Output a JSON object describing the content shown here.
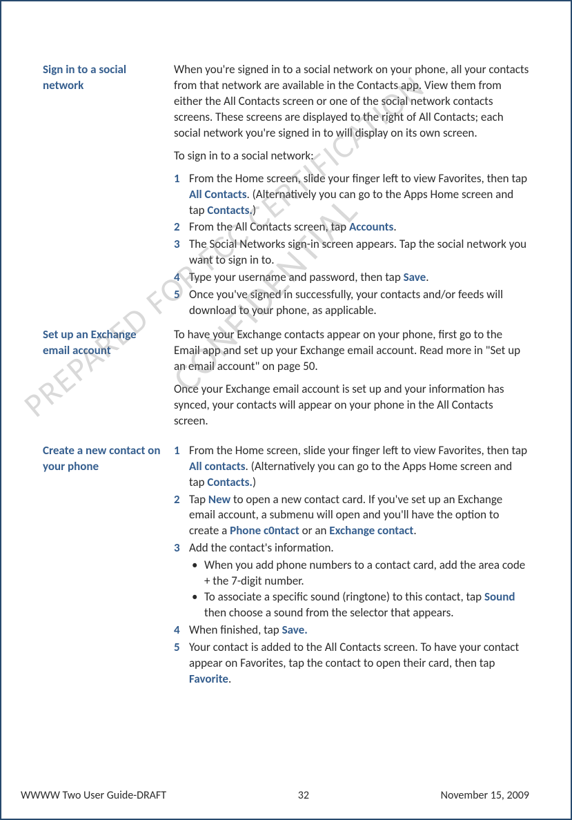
{
  "watermarks": {
    "wm1": "PREPARED FOR FCC CERTIFICATION",
    "wm2": "CONFIDENTIAL"
  },
  "sections": {
    "signin": {
      "heading": "Sign in to a social network",
      "p1": "When you're signed in to a social network on your phone, all your contacts from that network are available in the Contacts app. View them from either the All Contacts screen or one of the social network contacts screens. These screens are displayed to the right of All Contacts; each social network you're signed in to will display on its own screen.",
      "p2": "To sign in to a social network:",
      "step1_a": "From the Home screen, slide your finger left to view Favorites, then tap ",
      "step1_b": "All Contacts",
      "step1_c": ". (Alternatively you can go to the Apps Home screen and tap ",
      "step1_d": "Contacts.",
      "step1_e": ")",
      "step2_a": "From the All Contacts screen, tap ",
      "step2_b": "Accounts",
      "step2_c": ".",
      "step3": "The Social Networks sign-in screen appears. Tap the social network you want to sign in to.",
      "step4_a": "Type your username and password, then tap ",
      "step4_b": "Save",
      "step4_c": ".",
      "step5": "Once you've signed in successfully, your contacts and/or feeds will download to your phone, as applicable."
    },
    "exchange": {
      "heading": "Set up an Exchange email account",
      "p1": "To have your Exchange contacts appear on your phone, first go to the Email app and set up your Exchange email account. Read more in \"Set up an email account\" on page 50.",
      "p2": "Once your Exchange email account is set up and your information has synced, your contacts will appear on your phone in the All Contacts screen."
    },
    "create": {
      "heading": "Create a new contact on your phone",
      "step1_a": "From the Home screen, slide your finger left to view Favorites, then tap ",
      "step1_b": "All contacts",
      "step1_c": ". (Alternatively you can go to the Apps Home screen and tap ",
      "step1_d": "Contacts.",
      "step1_e": ")",
      "step2_a": "Tap ",
      "step2_b": "New",
      "step2_c": " to open a new contact card. If you've set up an Exchange email account, a submenu will open and you'll have the option to create a ",
      "step2_d": "Phone c0ntact",
      "step2_e": " or an ",
      "step2_f": "Exchange contact",
      "step2_g": ".",
      "step3": "Add the contact's information.",
      "bullet1": "When you add phone numbers to a contact card, add the area code + the 7-digit number.",
      "bullet2_a": "To associate a specific sound (ringtone) to this contact, tap ",
      "bullet2_b": "Sound",
      "bullet2_c": " then choose a sound from the selector that appears.",
      "step4_a": "When finished, tap ",
      "step4_b": "Save.",
      "step5_a": "Your contact is added to the All Contacts screen. To have your contact appear on Favorites, tap the contact to open their card, then tap ",
      "step5_b": "Favorite",
      "step5_c": "."
    }
  },
  "footer": {
    "left": "WWWW Two User Guide-DRAFT",
    "center": "32",
    "right": "November 15, 2009"
  },
  "nums": {
    "n1": "1",
    "n2": "2",
    "n3": "3",
    "n4": "4",
    "n5": "5"
  }
}
